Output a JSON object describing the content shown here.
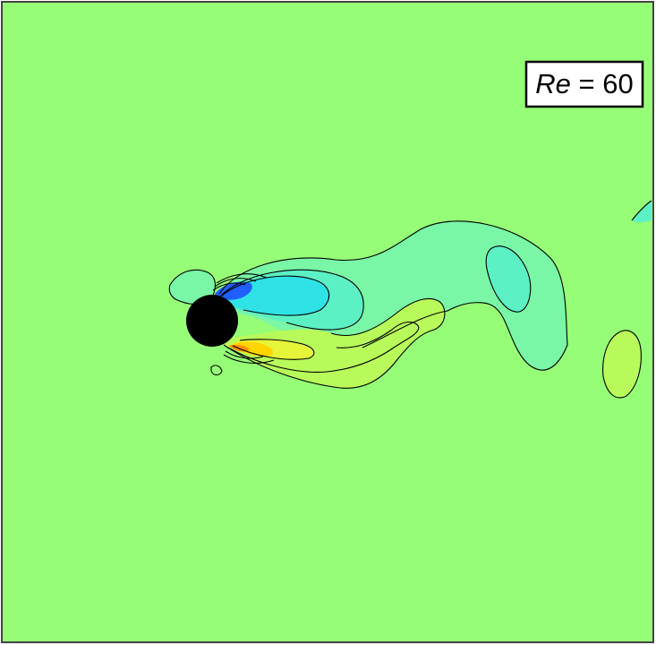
{
  "label": {
    "symbol": "Re",
    "relation": " = ",
    "value": "60"
  },
  "colors": {
    "background": "#96fd77",
    "frame": "#444444",
    "contour_line": "#000000",
    "cylinder": "#000000",
    "negative_deep": "#1f5fff",
    "negative_mid": "#2ee2e6",
    "negative_low": "#5bf1c4",
    "negative_faint": "#79f6a6",
    "positive_faint": "#b8fa5a",
    "positive_mid": "#e6f43a",
    "positive_deep": "#ffd400",
    "positive_peak": "#ff8c00"
  }
}
